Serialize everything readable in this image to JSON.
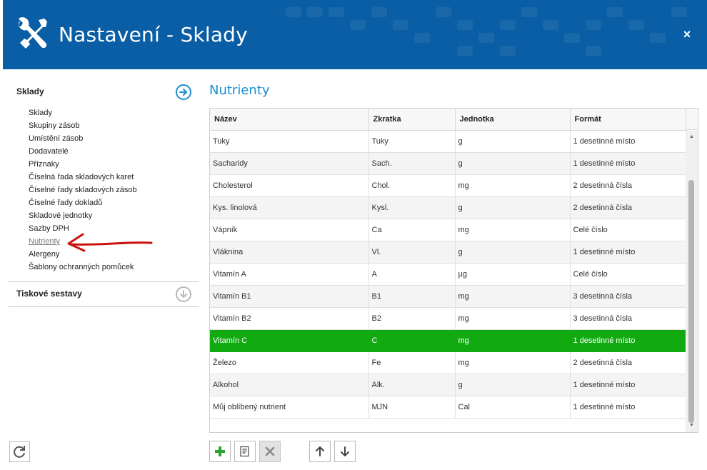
{
  "window": {
    "title": "Nastavení - Sklady",
    "close_label": "×"
  },
  "left": {
    "sections": [
      {
        "title": "Sklady",
        "items": [
          "Sklady",
          "Skupiny zásob",
          "Umístění zásob",
          "Dodavatelé",
          "Příznaky",
          "Číselná řada skladových karet",
          "Číselné řady skladových zásob",
          "Číselné řady dokladů",
          "Skladové jednotky",
          "Sazby DPH",
          "Nutrienty",
          "Alergeny",
          "Šablony ochranných pomůcek"
        ],
        "active_item": "Nutrienty"
      },
      {
        "title": "Tiskové sestavy"
      }
    ]
  },
  "main": {
    "title": "Nutrienty",
    "columns": [
      "Název",
      "Zkratka",
      "Jednotka",
      "Formát"
    ],
    "rows": [
      [
        "Tuky",
        "Tuky",
        "g",
        "1 desetinné místo"
      ],
      [
        "Sacharidy",
        "Sach.",
        "g",
        "1 desetinné místo"
      ],
      [
        "Cholesterol",
        "Chol.",
        "mg",
        "2 desetinná čísla"
      ],
      [
        "Kys. linolová",
        "Kysl.",
        "g",
        "2 desetinná čísla"
      ],
      [
        "Vápník",
        "Ca",
        "mg",
        "Celé číslo"
      ],
      [
        "Vláknina",
        "Vl.",
        "g",
        "1 desetinné místo"
      ],
      [
        "Vitamín A",
        "A",
        "µg",
        "Celé číslo"
      ],
      [
        "Vitamín B1",
        "B1",
        "mg",
        "3 desetinná čísla"
      ],
      [
        "Vitamín B2",
        "B2",
        "mg",
        "3 desetinná čísla"
      ],
      [
        "Vitamín C",
        "C",
        "mg",
        "1 desetinné místo"
      ],
      [
        "Železo",
        "Fe",
        "mg",
        "2 desetinná čísla"
      ],
      [
        "Alkohol",
        "Alk.",
        "g",
        "1 desetinné místo"
      ],
      [
        "Můj oblíbený nutrient",
        "MJN",
        "Cal",
        "1 desetinné místo"
      ]
    ],
    "selected_row": 9
  },
  "toolbar": {
    "icons": [
      "add-icon",
      "edit-icon",
      "delete-icon",
      "move-up-icon",
      "move-down-icon"
    ]
  },
  "colors": {
    "header": "#0a5ea5",
    "accent": "#1a8fd0",
    "selection": "#11aa11",
    "annotation_arrow": "#cc1111"
  }
}
